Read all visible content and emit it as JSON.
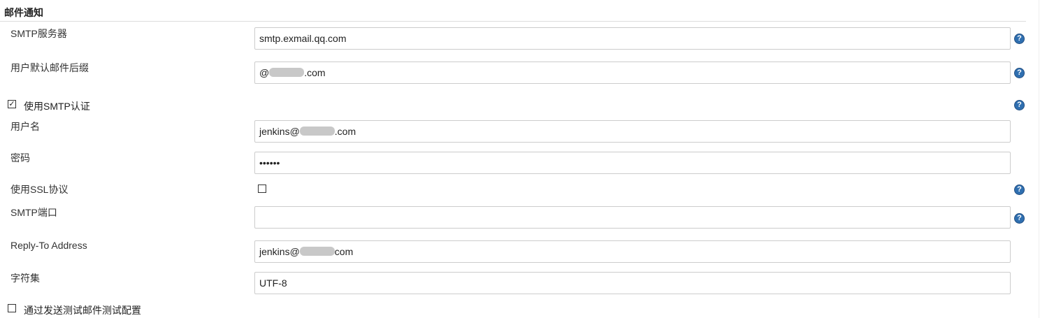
{
  "section": {
    "title": "邮件通知"
  },
  "smtp_server": {
    "label": "SMTP服务器",
    "value": "smtp.exmail.qq.com"
  },
  "default_suffix": {
    "label": "用户默认邮件后缀",
    "prefix": "@",
    "suffix": ".com"
  },
  "smtp_auth": {
    "label": "使用SMTP认证",
    "checked": true,
    "check_glyph": "✓"
  },
  "username": {
    "label": "用户名",
    "prefix": "jenkins@",
    "suffix": ".com"
  },
  "password": {
    "label": "密码",
    "value": "••••••"
  },
  "use_ssl": {
    "label": "使用SSL协议",
    "checked": false
  },
  "smtp_port": {
    "label": "SMTP端口",
    "value": ""
  },
  "reply_to": {
    "label": "Reply-To Address",
    "prefix": "jenkins@",
    "suffix": "com"
  },
  "charset": {
    "label": "字符集",
    "value": "UTF-8"
  },
  "test_config": {
    "label": "通过发送测试邮件测试配置",
    "checked": false
  },
  "help": {
    "glyph": "?"
  },
  "colors": {
    "help_icon": "#2f6fb0",
    "input_border": "#cccccc",
    "text": "#333333"
  }
}
